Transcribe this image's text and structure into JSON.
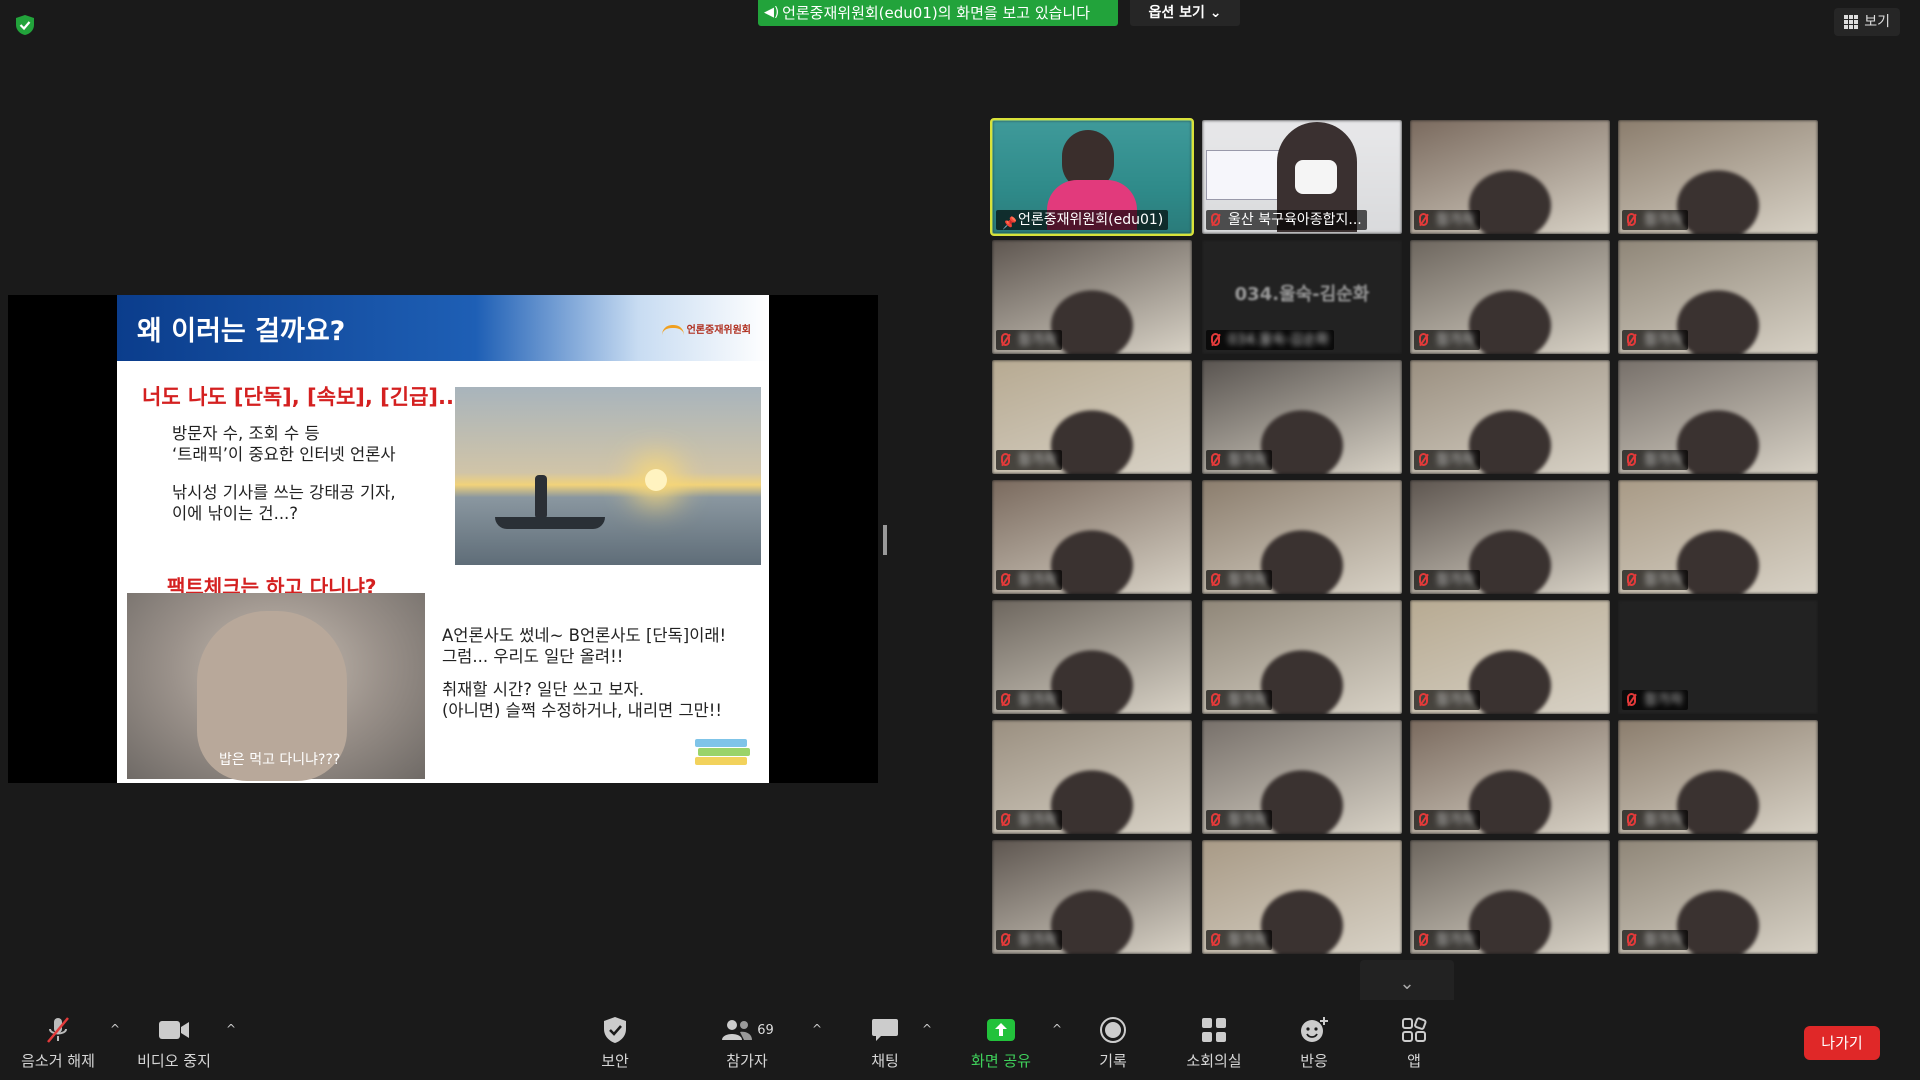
{
  "top": {
    "share_banner": "언론중재위원회(edu01)의 화면을 보고 있습니다",
    "options_label": "옵션 보기",
    "view_label": "보기"
  },
  "colors": {
    "share_green": "#22a33b",
    "active_speaker_border": "#d9e23a",
    "leave_red": "#e02828",
    "mute_red": "#e23a3a"
  },
  "slide": {
    "title": "왜 이러는 걸까요?",
    "logo_text": "언론중재위원회",
    "headline": "너도 나도 [단독], [속보], [긴급]...",
    "text1_line1": "방문자 수, 조회 수 등",
    "text1_line2": "‘트래픽’이 중요한 인터넷 언론사",
    "text2_line1": "낚시성 기사를 쓰는 강태공 기자,",
    "text2_line2": "이에 낚이는 건...?",
    "headline2": "팩트체크는 하고 다니냐?",
    "photo2_caption": "밥은 먹고 다니냐???",
    "text3_line1": "A언론사도 썼네~ B언론사도 [단독]이래!",
    "text3_line2": "그럼... 우리도 일단 올려!!",
    "text4_line1": "취재할 시간? 일단 쓰고 보자.",
    "text4_line2": "(아니면) 슬쩍 수정하거나, 내리면 그만!!"
  },
  "gallery": {
    "tile1_name": "언론중재위원회(edu01)",
    "tile2_name": "울산 북구육아종합지...",
    "tile6_center": "034.울숙-김순화",
    "tile6_name": "034.울숙-김순화",
    "blurred_label": "참가자"
  },
  "toolbar": {
    "mute": "음소거 해제",
    "video": "비디오 중지",
    "security": "보안",
    "participants": "참가자",
    "participants_count": "69",
    "chat": "채팅",
    "share": "화면 공유",
    "record": "기록",
    "breakout": "소회의실",
    "reactions": "반응",
    "apps": "앱",
    "leave": "나가기"
  }
}
